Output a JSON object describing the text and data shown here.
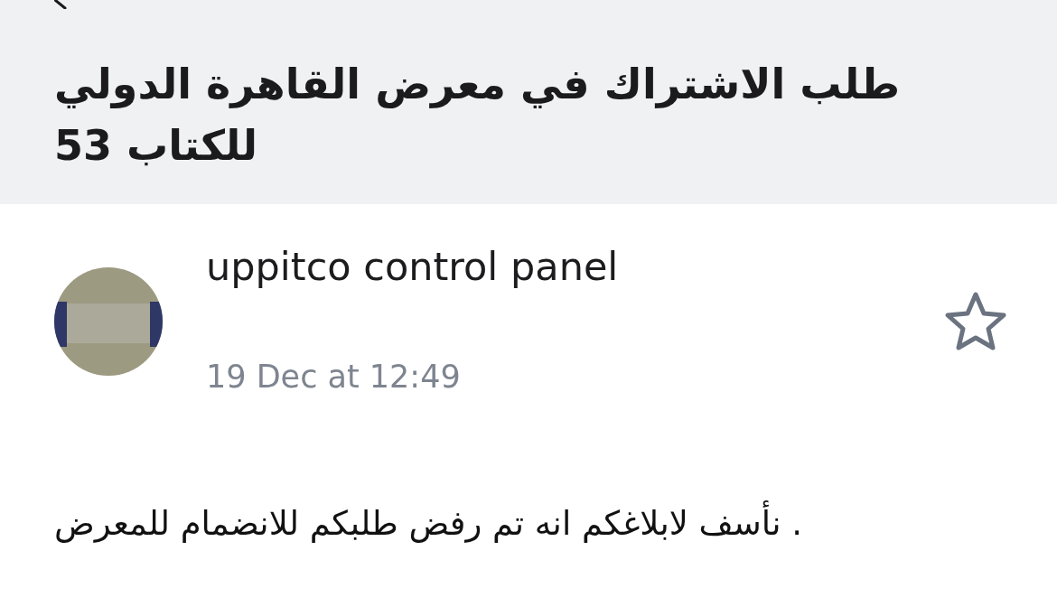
{
  "message": {
    "subject": "طلب الاشتراك في معرض القاهرة الدولي للكتاب 53",
    "sender": {
      "name": "uppitco control panel"
    },
    "date": "19 Dec at 12:49",
    "starred": false,
    "body": "نأسف لابلاغكم انه تم رفض طلبكم للانضمام للمعرض ."
  }
}
